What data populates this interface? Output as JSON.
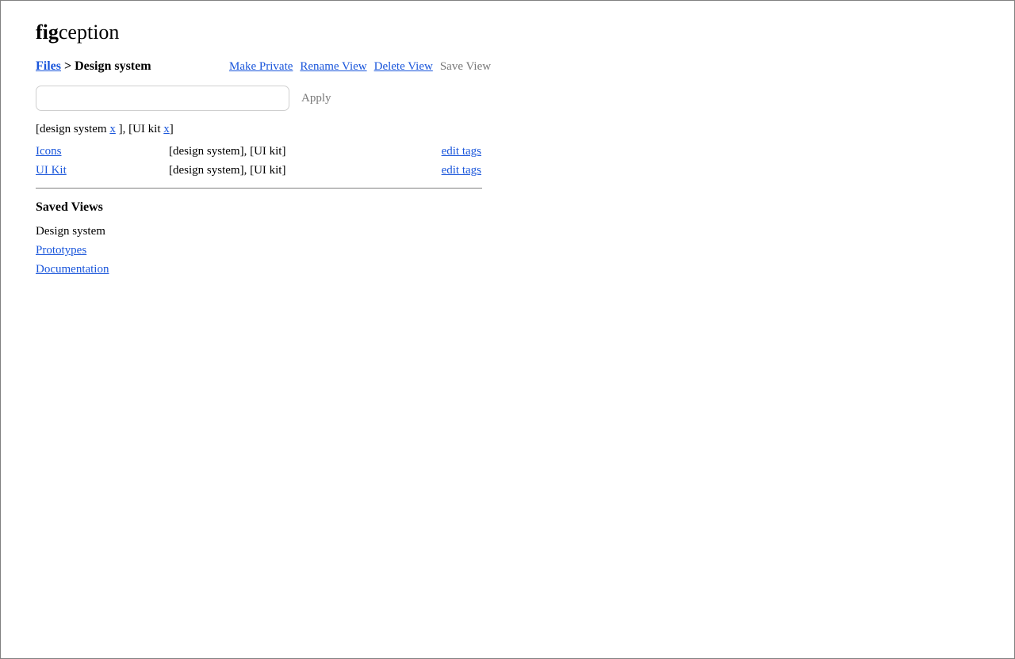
{
  "app": {
    "logo_bold": "fig",
    "logo_rest": "ception"
  },
  "breadcrumb": {
    "root": "Files",
    "separator": " > ",
    "current": "Design system"
  },
  "view_actions": {
    "make_private": "Make Private",
    "rename_view": "Rename View",
    "delete_view": "Delete View",
    "save_view": "Save View"
  },
  "search": {
    "value": "",
    "placeholder": "",
    "apply_label": "Apply"
  },
  "filters": {
    "open": "[",
    "tag1": "design system",
    "remove1": "x",
    "mid": " ], [",
    "tag2": "UI kit",
    "remove2": "x",
    "close": "]"
  },
  "files": [
    {
      "name": "Icons",
      "tags": "[design system], [UI kit]",
      "edit_label": "edit tags"
    },
    {
      "name": "UI Kit",
      "tags": "[design system], [UI kit]",
      "edit_label": "edit tags"
    }
  ],
  "saved_views": {
    "title": "Saved Views",
    "items": [
      {
        "label": "Design system",
        "current": true
      },
      {
        "label": "Prototypes",
        "current": false
      },
      {
        "label": "Documentation",
        "current": false
      }
    ]
  },
  "colors": {
    "link": "#1a56db",
    "disabled": "#777777",
    "border": "#808080"
  }
}
